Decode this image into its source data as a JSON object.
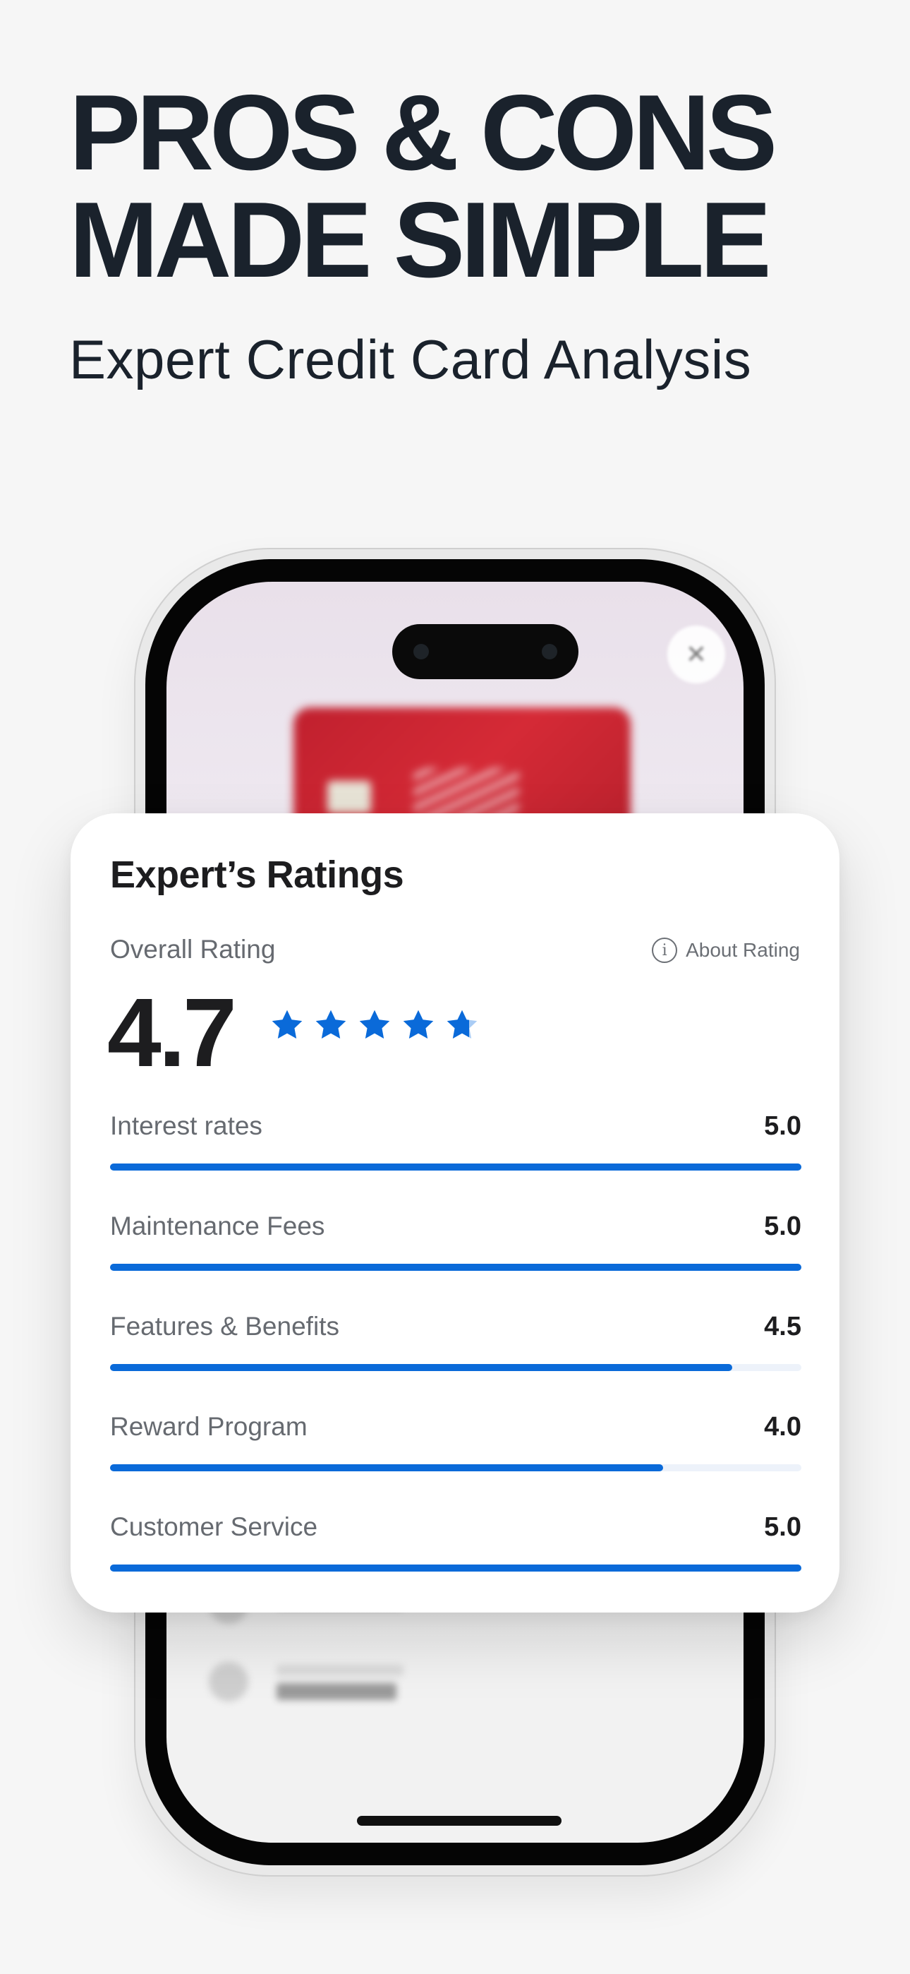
{
  "headline": {
    "line1": "PROS & CONS",
    "line2": "MADE SIMPLE",
    "subtitle": "Expert Credit Card Analysis"
  },
  "phone": {
    "close_icon": "close-icon",
    "card_brand": "red credit card (blurred)"
  },
  "ratings_card": {
    "title": "Expert’s Ratings",
    "overall_label": "Overall Rating",
    "about_rating_label": "About Rating",
    "about_rating_icon": "info-icon",
    "overall_value": "4.7",
    "overall_stars": 4.7,
    "max_stars": 5,
    "accent_color": "#0a6ad9",
    "metrics": [
      {
        "label": "Interest rates",
        "value": "5.0",
        "fraction": 1.0
      },
      {
        "label": "Maintenance Fees",
        "value": "5.0",
        "fraction": 1.0
      },
      {
        "label": "Features & Benefits",
        "value": "4.5",
        "fraction": 0.9
      },
      {
        "label": "Reward Program",
        "value": "4.0",
        "fraction": 0.8
      },
      {
        "label": "Customer Service",
        "value": "5.0",
        "fraction": 1.0
      }
    ]
  }
}
